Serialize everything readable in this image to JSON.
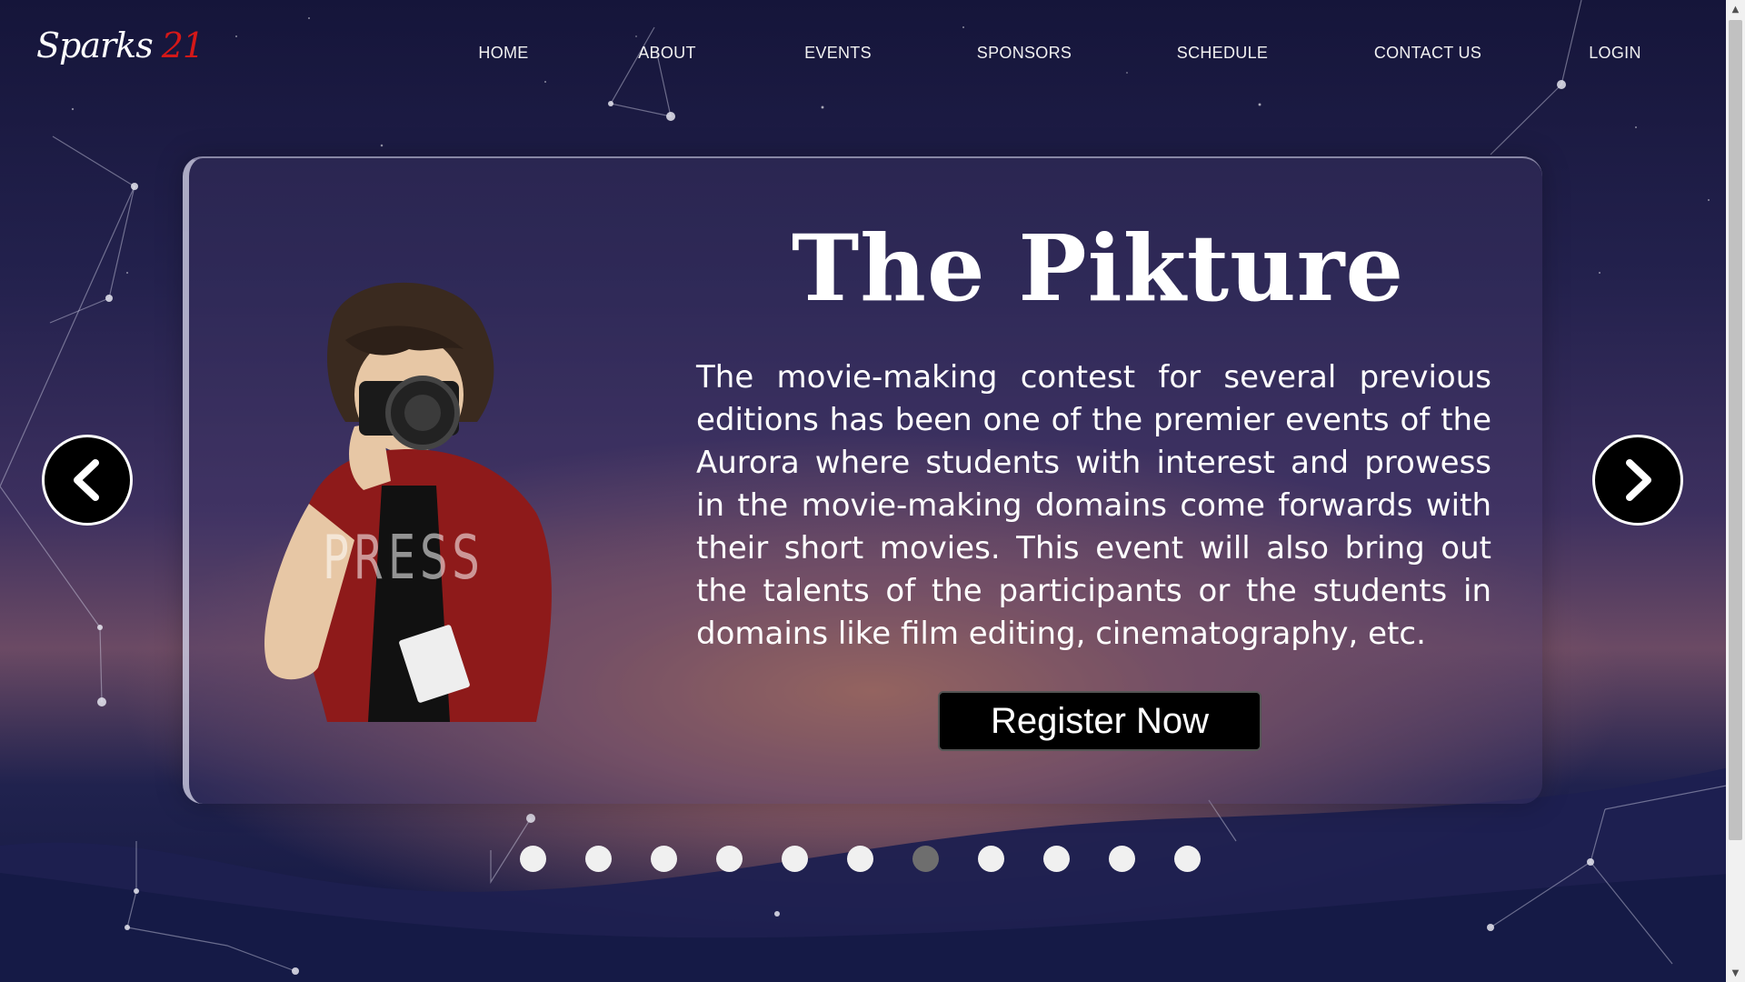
{
  "logo": {
    "text": "Sparks",
    "year": "21"
  },
  "nav": {
    "items": [
      "HOME",
      "ABOUT",
      "EVENTS",
      "SPONSORS",
      "SCHEDULE",
      "CONTACT US",
      "LOGIN"
    ]
  },
  "slide": {
    "title": "The Pikture",
    "description": "The movie-making contest for several previous editions has been one of the premier events of the Aurora where students with interest and prowess in the movie-making domains come forwards with their short movies. This event will also bring out the talents of the participants or the students in domains like film editing, cinematography, etc.",
    "register_label": "Register Now",
    "illustration_text": "PRESS"
  },
  "carousel": {
    "slide_count": 11,
    "active_index": 6,
    "prev_icon": "chevron-left-icon",
    "next_icon": "chevron-right-icon"
  },
  "colors": {
    "accent_year": "#d41818",
    "button_bg": "#000000",
    "dot_inactive": "#f0f0f0",
    "dot_active": "#6e6e6e"
  }
}
